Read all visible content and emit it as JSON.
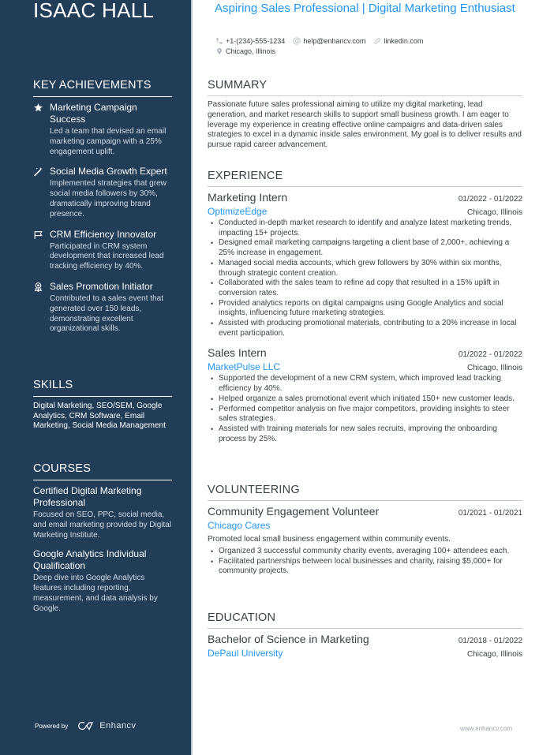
{
  "name": "ISAAC HALL",
  "headline": "Aspiring Sales Professional | Digital Marketing Enthusiast",
  "contacts": {
    "phone": {
      "icon": "phone-icon",
      "text": "+1-(234)-555-1234"
    },
    "email": {
      "icon": "at-icon",
      "text": "help@enhancv.com"
    },
    "linkedin": {
      "icon": "link-icon",
      "text": "linkedin.com"
    },
    "location": {
      "icon": "map-pin-icon",
      "text": "Chicago, Illinois"
    }
  },
  "sidebar": {
    "achievements": {
      "heading": "KEY ACHIEVEMENTS",
      "items": [
        {
          "icon": "star-icon",
          "title": "Marketing Campaign Success",
          "desc": "Led a team that devised an email marketing campaign with a 25% engagement uplift."
        },
        {
          "icon": "magic-wand-icon",
          "title": "Social Media Growth Expert",
          "desc": "Implemented strategies that grew social media followers by 30%, dramatically improving brand presence."
        },
        {
          "icon": "flag-icon",
          "title": "CRM Efficiency Innovator",
          "desc": "Participated in CRM system development that increased lead tracking efficiency by 40%."
        },
        {
          "icon": "award-ribbon-icon",
          "title": "Sales Promotion Initiator",
          "desc": "Contributed to a sales event that generated over 150 leads, demonstrating excellent organizational skills."
        }
      ]
    },
    "skills": {
      "heading": "SKILLS",
      "text": "Digital Marketing, SEO/SEM, Google Analytics, CRM Software, Email Marketing, Social Media Management"
    },
    "courses": {
      "heading": "COURSES",
      "items": [
        {
          "title": "Certified Digital Marketing Professional",
          "desc": "Focused on SEO, PPC, social media, and email marketing provided by Digital Marketing Institute."
        },
        {
          "title": "Google Analytics Individual Qualification",
          "desc": "Deep dive into Google Analytics features including reporting, measurement, and data analysis by Google."
        }
      ]
    },
    "powered_by": "Powered by",
    "brand": "Enhancv"
  },
  "summary": {
    "heading": "SUMMARY",
    "text": "Passionate future sales professional aiming to utilize my digital marketing, lead generation, and market research skills to support small business growth. I am eager to leverage my experience in creating effective online campaigns and data-driven sales strategies to excel in a dynamic inside sales environment. My goal is to deliver results and pursue rapid career advancement."
  },
  "experience": {
    "heading": "EXPERIENCE",
    "items": [
      {
        "role": "Marketing Intern",
        "dates": "01/2022 - 01/2022",
        "company": "OptimizeEdge",
        "location": "Chicago, Illinois",
        "bullets": [
          "Conducted in-depth market research to identify and analyze latest marketing trends, impacting 15+ projects.",
          "Designed email marketing campaigns targeting a client base of 2,000+, achieving a 25% increase in engagement.",
          "Managed social media accounts, which grew followers by 30% within six months, through strategic content creation.",
          "Collaborated with the sales team to refine ad copy that resulted in a 15% uplift in conversion rates.",
          "Provided analytics reports on digital campaigns using Google Analytics and social insights, influencing future marketing strategies.",
          "Assisted with producing promotional materials, contributing to a 20% increase in local event participation."
        ]
      },
      {
        "role": "Sales Intern",
        "dates": "01/2022 - 01/2022",
        "company": "MarketPulse LLC",
        "location": "Chicago, Illinois",
        "bullets": [
          "Supported the development of a new CRM system, which improved lead tracking efficiency by 40%.",
          "Helped organize a sales promotional event which initiated 150+ new customer leads.",
          "Performed competitor analysis on five major competitors, providing insights to steer sales strategies.",
          "Assisted with training materials for new sales recruits, improving the onboarding process by 25%."
        ]
      }
    ]
  },
  "volunteering": {
    "heading": "VOLUNTEERING",
    "role": "Community Engagement Volunteer",
    "dates": "01/2021 - 01/2021",
    "company": "Chicago Cares",
    "desc": "Promoted local small business engagement within community events.",
    "bullets": [
      "Organized 3 successful community charity events, averaging 100+ attendees each.",
      "Facilitated partnerships between local businesses and charity, raising $5,000+ for community projects."
    ]
  },
  "education": {
    "heading": "EDUCATION",
    "degree": "Bachelor of Science in Marketing",
    "dates": "01/2018 - 01/2022",
    "school": "DePaul University",
    "location": "Chicago, Illinois"
  },
  "footer": {
    "site": "www.enhancv.com"
  },
  "colors": {
    "sidebar": "#223d58",
    "accent": "#2196f3",
    "text": "#384347"
  }
}
